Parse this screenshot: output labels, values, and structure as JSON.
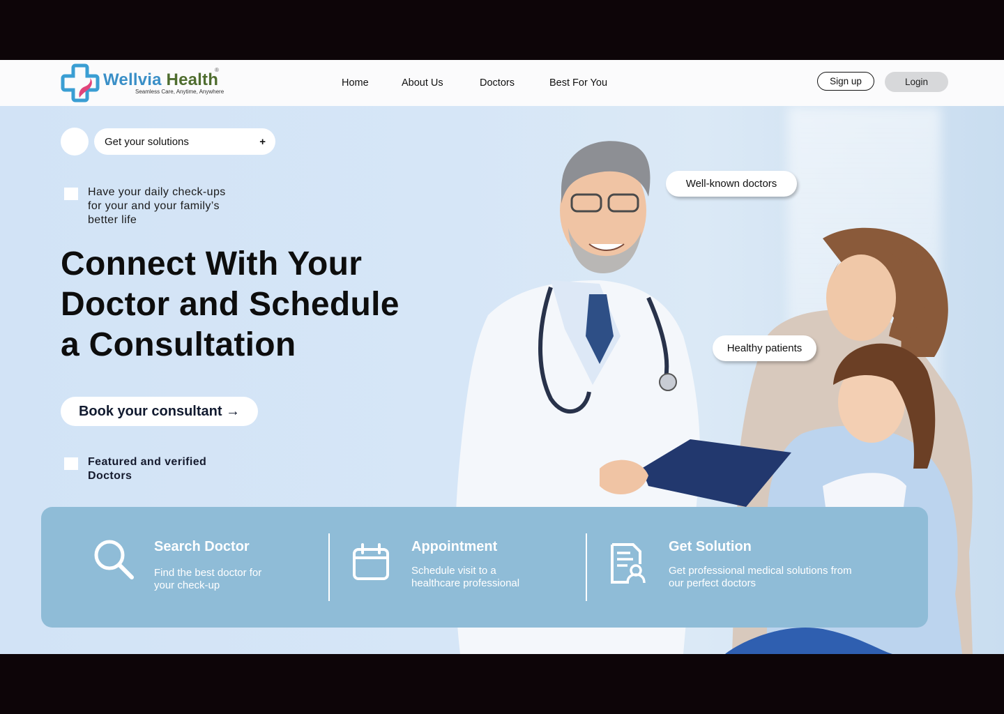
{
  "brand": {
    "name_part1": "Wellvia",
    "name_part2": "Health",
    "tagline": "Seamless Care, Anytime, Anywhere",
    "registered": "®",
    "color_primary": "#3a8fc7",
    "color_secondary": "#4f6d2f"
  },
  "nav": {
    "items": [
      {
        "label": "Home"
      },
      {
        "label": "About Us"
      },
      {
        "label": "Doctors"
      },
      {
        "label": "Best For You"
      }
    ],
    "signup_label": "Sign up",
    "login_label": "Login"
  },
  "hero": {
    "solutions_label": "Get your solutions",
    "solutions_icon": "plus-icon",
    "checkup_text": "Have your daily check-ups for your and your family’s better life",
    "headline": "Connect With Your Doctor and Schedule a Consultation",
    "cta_label": "Book your consultant →",
    "featured_text": "Featured and verified Doctors",
    "tags": [
      {
        "label": "Well-known doctors"
      },
      {
        "label": "Healthy patients"
      }
    ]
  },
  "features": [
    {
      "icon": "search-icon",
      "title": "Search Doctor",
      "desc": "Find the best doctor for your check-up"
    },
    {
      "icon": "calendar-icon",
      "title": "Appointment",
      "desc": "Schedule visit to a healthcare professional"
    },
    {
      "icon": "document-user-icon",
      "title": "Get Solution",
      "desc": "Get professional medical solutions from our perfect doctors"
    }
  ],
  "colors": {
    "hero_bg": "#d6e6f7",
    "feature_bar": "#8fbcd7",
    "login_bg": "#d7d8da"
  }
}
